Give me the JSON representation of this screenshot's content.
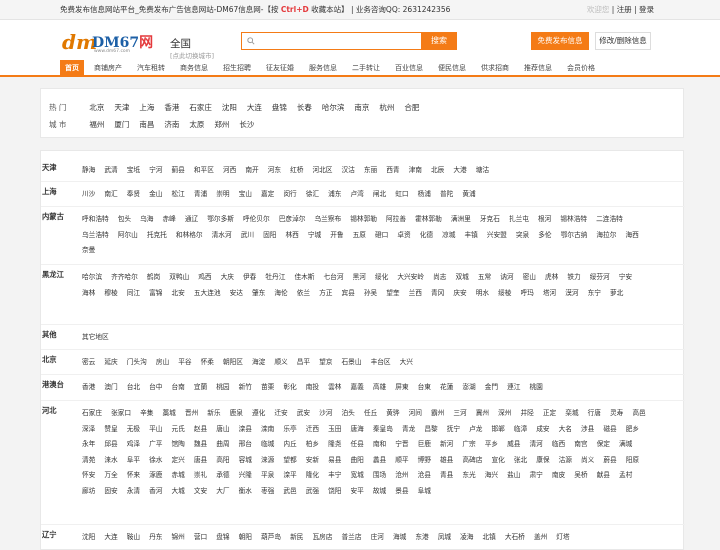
{
  "topbar": {
    "title": "免费发布信息网站平台_免费发布广告信息网站-DM67信息网-【按",
    "shortcut": "Ctrl+D",
    "bookmark": "收藏本站】",
    "divider": "|",
    "qq_label": "业务咨询QQ:",
    "qq": "2631242356",
    "welcome": "欢迎您",
    "register": "注册",
    "login": "登录"
  },
  "logo": {
    "mark": "dm",
    "brand_a": "DM67",
    "brand_b": "网",
    "url": "www.dm67.com"
  },
  "city": {
    "name": "全国",
    "switch": "[点此切换城市]"
  },
  "search": {
    "placeholder": "",
    "button": "搜索"
  },
  "header_buttons": {
    "publish": "免费发布信息",
    "manage": "修改/删除信息"
  },
  "nav": [
    "首页",
    "商铺房产",
    "汽车租转",
    "商务信息",
    "招生招聘",
    "征友征婚",
    "服务信息",
    "二手转让",
    "百业信息",
    "便民信息",
    "供求招商",
    "推荐信息",
    "会员价格"
  ],
  "hot": {
    "label": "热 门",
    "cities": [
      "北京",
      "天津",
      "上海",
      "香港",
      "石家庄",
      "沈阳",
      "大连",
      "盘锦",
      "长春",
      "哈尔滨",
      "南京",
      "杭州",
      "合肥"
    ],
    "city_label": "城 市",
    "cities2": [
      "福州",
      "厦门",
      "南昌",
      "济南",
      "太原",
      "郑州",
      "长沙"
    ]
  },
  "provinces": [
    {
      "name": "天津",
      "cities": [
        "静海",
        "武清",
        "宝坻",
        "宁河",
        "蓟县",
        "和平区",
        "河西",
        "南开",
        "河东",
        "红桥",
        "河北区",
        "汉沽",
        "东丽",
        "西青",
        "津南",
        "北辰",
        "大港",
        "塘沽"
      ]
    },
    {
      "name": "上海",
      "cities": [
        "川沙",
        "南汇",
        "奉贤",
        "金山",
        "松江",
        "青浦",
        "崇明",
        "宝山",
        "嘉定",
        "闵行",
        "徐汇",
        "浦东",
        "卢湾",
        "闸北",
        "虹口",
        "杨浦",
        "普陀",
        "黄浦"
      ]
    },
    {
      "name": "内蒙古",
      "cities": [
        "呼和浩特",
        "包头",
        "乌海",
        "赤峰",
        "通辽",
        "鄂尔多斯",
        "呼伦贝尔",
        "巴彦淖尔",
        "乌兰察布",
        "锡林郭勒",
        "阿拉善",
        "霍林郭勒",
        "满洲里",
        "牙克石",
        "扎兰屯",
        "根河",
        "锡林浩特",
        "二连浩特",
        "乌兰浩特",
        "阿尔山",
        "托克托",
        "和林格尔",
        "清水河",
        "武川",
        "固阳",
        "林西",
        "宁城",
        "开鲁",
        "五原",
        "磴口",
        "卓资",
        "化德",
        "凉城",
        "丰镇",
        "兴安盟",
        "突泉",
        "多伦",
        "鄂尔古纳",
        "海拉尔",
        "海西",
        "奈曼"
      ]
    },
    {
      "name": "黑龙江",
      "cities": [
        "哈尔滨",
        "齐齐哈尔",
        "鹤岗",
        "双鸭山",
        "鸡西",
        "大庆",
        "伊春",
        "牡丹江",
        "佳木斯",
        "七台河",
        "黑河",
        "绥化",
        "大兴安岭",
        "尚志",
        "双城",
        "五常",
        "讷河",
        "密山",
        "虎林",
        "铁力",
        "绥芬河",
        "宁安",
        "海林",
        "穆棱",
        "同江",
        "富锦",
        "北安",
        "五大连池",
        "安达",
        "肇东",
        "海伦",
        "依兰",
        "方正",
        "宾县",
        "孙吴",
        "望奎",
        "兰西",
        "青冈",
        "庆安",
        "明水",
        "绥棱",
        "呼玛",
        "塔河",
        "漠河",
        "东宁",
        "萝北"
      ]
    },
    {
      "name": "其他",
      "cities": [
        "其它地区"
      ]
    },
    {
      "name": "北京",
      "cities": [
        "密云",
        "延庆",
        "门头沟",
        "房山",
        "平谷",
        "怀柔",
        "朝阳区",
        "海淀",
        "顺义",
        "昌平",
        "望京",
        "石景山",
        "丰台区",
        "大兴"
      ]
    },
    {
      "name": "港澳台",
      "cities": [
        "香港",
        "澳门",
        "台北",
        "台中",
        "台南",
        "宜蘭",
        "桃园",
        "新竹",
        "苗栗",
        "彰化",
        "南投",
        "雲林",
        "嘉義",
        "高雄",
        "屏東",
        "台東",
        "花蓮",
        "澎湖",
        "金門",
        "連江",
        "桃園"
      ]
    },
    {
      "name": "河北",
      "cities": [
        "石家庄",
        "张家口",
        "辛集",
        "藁城",
        "晋州",
        "新乐",
        "鹿泉",
        "遵化",
        "迁安",
        "武安",
        "沙河",
        "泊头",
        "任丘",
        "黄骅",
        "河间",
        "霸州",
        "三河",
        "冀州",
        "深州",
        "井陉",
        "正定",
        "栾城",
        "行唐",
        "灵寿",
        "高邑",
        "深泽",
        "赞皇",
        "无极",
        "平山",
        "元氏",
        "赵县",
        "唐山",
        "滦县",
        "滦南",
        "乐亭",
        "迁西",
        "玉田",
        "唐海",
        "秦皇岛",
        "青龙",
        "昌黎",
        "抚宁",
        "卢龙",
        "邯郸",
        "临漳",
        "成安",
        "大名",
        "涉县",
        "磁县",
        "肥乡",
        "永年",
        "邱县",
        "鸡泽",
        "广平",
        "馆陶",
        "魏县",
        "曲周",
        "邢台",
        "临城",
        "内丘",
        "柏乡",
        "隆尧",
        "任县",
        "南和",
        "宁晋",
        "巨鹿",
        "新河",
        "广宗",
        "平乡",
        "威县",
        "清河",
        "临西",
        "南宫",
        "保定",
        "满城",
        "清苑",
        "涞水",
        "阜平",
        "徐水",
        "定兴",
        "唐县",
        "高阳",
        "容城",
        "涞源",
        "望都",
        "安新",
        "易县",
        "曲阳",
        "蠡县",
        "顺平",
        "博野",
        "雄县",
        "高碑店",
        "宣化",
        "张北",
        "康保",
        "沽源",
        "尚义",
        "蔚县",
        "阳原",
        "怀安",
        "万全",
        "怀来",
        "涿鹿",
        "赤城",
        "崇礼",
        "承德",
        "兴隆",
        "平泉",
        "滦平",
        "隆化",
        "丰宁",
        "宽城",
        "围场",
        "沧州",
        "沧县",
        "青县",
        "东光",
        "海兴",
        "盐山",
        "肃宁",
        "南皮",
        "吴桥",
        "献县",
        "孟村",
        "廊坊",
        "固安",
        "永清",
        "香河",
        "大城",
        "文安",
        "大厂",
        "衡水",
        "枣强",
        "武邑",
        "武强",
        "饶阳",
        "安平",
        "故城",
        "景县",
        "阜城"
      ]
    },
    {
      "name": "辽宁",
      "cities": [
        "沈阳",
        "大连",
        "鞍山",
        "丹东",
        "锦州",
        "营口",
        "盘锦",
        "朝阳",
        "葫芦岛",
        "新民",
        "瓦房店",
        "普兰店",
        "庄河",
        "海城",
        "东港",
        "凤城",
        "凌海",
        "北镇",
        "大石桥",
        "盖州",
        "灯塔"
      ]
    }
  ]
}
